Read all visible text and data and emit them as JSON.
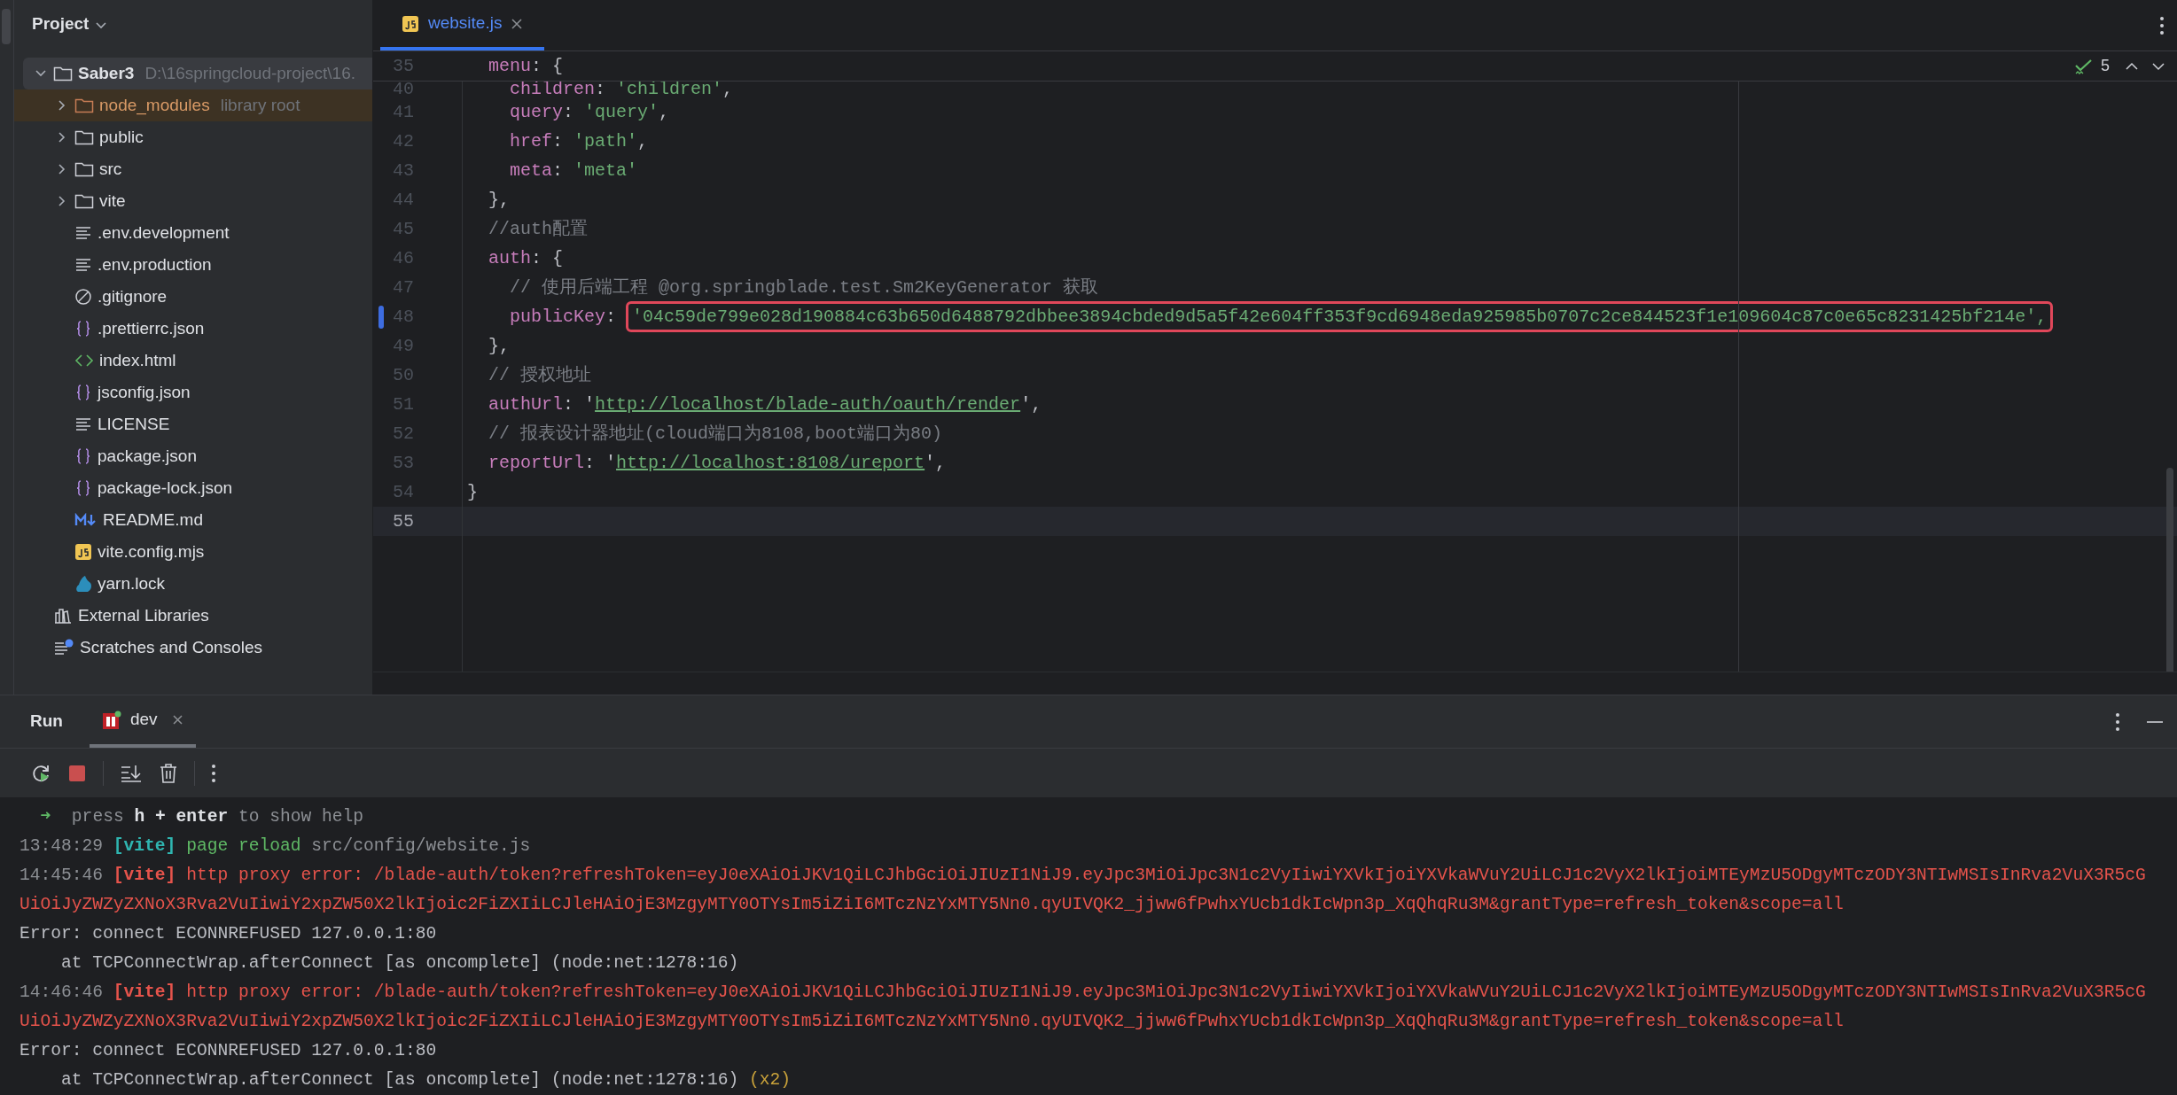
{
  "project_panel": {
    "title": "Project",
    "tree": [
      {
        "label": "Saber3",
        "hint": "D:\\16springcloud-project\\16.",
        "kind": "folder",
        "expanded": true,
        "children": [
          {
            "label": "node_modules",
            "hint": "library root",
            "kind": "library",
            "expanded": false
          },
          {
            "label": "public",
            "kind": "folder",
            "expanded": false
          },
          {
            "label": "src",
            "kind": "folder",
            "expanded": false
          },
          {
            "label": "vite",
            "kind": "folder",
            "expanded": false
          },
          {
            "label": ".env.development",
            "kind": "text"
          },
          {
            "label": ".env.production",
            "kind": "text"
          },
          {
            "label": ".gitignore",
            "kind": "ignore"
          },
          {
            "label": ".prettierrc.json",
            "kind": "json"
          },
          {
            "label": "index.html",
            "kind": "html"
          },
          {
            "label": "jsconfig.json",
            "kind": "json"
          },
          {
            "label": "LICENSE",
            "kind": "text"
          },
          {
            "label": "package.json",
            "kind": "json"
          },
          {
            "label": "package-lock.json",
            "kind": "json"
          },
          {
            "label": "README.md",
            "kind": "markdown"
          },
          {
            "label": "vite.config.mjs",
            "kind": "js"
          },
          {
            "label": "yarn.lock",
            "kind": "yarn"
          }
        ]
      },
      {
        "label": "External Libraries",
        "kind": "libraries"
      },
      {
        "label": "Scratches and Consoles",
        "kind": "scratches"
      }
    ]
  },
  "editor": {
    "tabs": [
      {
        "label": "website.js",
        "selected": true
      }
    ],
    "inspections": "5",
    "lines": [
      {
        "number": "35",
        "sticky": true,
        "tokens": [
          {
            "t": "  menu",
            "kind": "key"
          },
          {
            "t": ": {",
            "kind": "punct"
          }
        ]
      },
      {
        "number": "40",
        "cut": true,
        "tokens": [
          {
            "t": "    children",
            "kind": "key"
          },
          {
            "t": ": ",
            "kind": "punct"
          },
          {
            "t": "'children'",
            "kind": "string"
          },
          {
            "t": ",",
            "kind": "punct"
          }
        ]
      },
      {
        "number": "41",
        "tokens": [
          {
            "t": "    query",
            "kind": "key"
          },
          {
            "t": ": ",
            "kind": "punct"
          },
          {
            "t": "'query'",
            "kind": "string"
          },
          {
            "t": ",",
            "kind": "punct"
          }
        ]
      },
      {
        "number": "42",
        "tokens": [
          {
            "t": "    href",
            "kind": "key"
          },
          {
            "t": ": ",
            "kind": "punct"
          },
          {
            "t": "'path'",
            "kind": "string"
          },
          {
            "t": ",",
            "kind": "punct"
          }
        ]
      },
      {
        "number": "43",
        "tokens": [
          {
            "t": "    meta",
            "kind": "key"
          },
          {
            "t": ": ",
            "kind": "punct"
          },
          {
            "t": "'meta'",
            "kind": "string"
          }
        ]
      },
      {
        "number": "44",
        "tokens": [
          {
            "t": "  },",
            "kind": "punct"
          }
        ]
      },
      {
        "number": "45",
        "tokens": [
          {
            "t": "  //auth配置",
            "kind": "comment"
          }
        ]
      },
      {
        "number": "46",
        "tokens": [
          {
            "t": "  auth",
            "kind": "key"
          },
          {
            "t": ": {",
            "kind": "punct"
          }
        ]
      },
      {
        "number": "47",
        "tokens": [
          {
            "t": "    // 使用后端工程 @org.springblade.test.Sm2KeyGenerator 获取",
            "kind": "comment"
          }
        ]
      },
      {
        "number": "48",
        "modified": true,
        "tokens": [
          {
            "t": "    publicKey",
            "kind": "key"
          },
          {
            "t": ": ",
            "kind": "punct"
          },
          {
            "t": "'04c59de799e028d190884c63b650d6488792dbbee3894cbded9d5a5f42e604ff353f9cd6948eda925985b0707c2ce844523f1e109604c87c0e65c8231425bf214e',",
            "kind": "string",
            "boxed": true
          }
        ]
      },
      {
        "number": "49",
        "tokens": [
          {
            "t": "  },",
            "kind": "punct"
          }
        ]
      },
      {
        "number": "50",
        "tokens": [
          {
            "t": "  // 授权地址",
            "kind": "comment"
          }
        ]
      },
      {
        "number": "51",
        "tokens": [
          {
            "t": "  authUrl",
            "kind": "key"
          },
          {
            "t": ": '",
            "kind": "punct"
          },
          {
            "t": "http://localhost/blade-auth/oauth/render",
            "kind": "link"
          },
          {
            "t": "',",
            "kind": "punct"
          }
        ]
      },
      {
        "number": "52",
        "tokens": [
          {
            "t": "  // 报表设计器地址(cloud端口为8108,boot端口为80)",
            "kind": "comment"
          }
        ]
      },
      {
        "number": "53",
        "tokens": [
          {
            "t": "  reportUrl",
            "kind": "key"
          },
          {
            "t": ": '",
            "kind": "punct"
          },
          {
            "t": "http://localhost:8108/ureport",
            "kind": "link"
          },
          {
            "t": "',",
            "kind": "punct"
          }
        ]
      },
      {
        "number": "54",
        "tokens": [
          {
            "t": "}",
            "kind": "punct"
          }
        ]
      },
      {
        "number": "55",
        "current": true
      }
    ]
  },
  "run_panel": {
    "title": "Run",
    "tabs": [
      {
        "label": "dev",
        "selected": true
      }
    ],
    "console": [
      {
        "segments": [
          {
            "t": "  ➜  ",
            "kind": "green"
          },
          {
            "t": "press ",
            "kind": "dim"
          },
          {
            "t": "h + enter",
            "kind": "bold"
          },
          {
            "t": " to show help",
            "kind": "dim"
          }
        ]
      },
      {
        "segments": [
          {
            "t": "13:48:29 ",
            "kind": "dim"
          },
          {
            "t": "[vite]",
            "kind": "cyan"
          },
          {
            "t": " page reload",
            "kind": "green"
          },
          {
            "t": " src/config/website.js",
            "kind": "dim"
          }
        ]
      },
      {
        "segments": [
          {
            "t": "14:45:46 ",
            "kind": "dim"
          },
          {
            "t": "[vite]",
            "kind": "redbold"
          },
          {
            "t": " http proxy error: /blade-auth/token?refreshToken=eyJ0eXAiOiJKV1QiLCJhbGciOiJIUzI1NiJ9.eyJpc3MiOiJpc3N1c2VyIiwiYXVkIjoiYXVkaWVuY2UiLCJ1c2VyX2lkIjoiMTEyMzU5ODgyMTczODY3NTIwMSIsInRva2VuX3R5cGUiOiJyZWZyZXNoX3Rva2VuIiwiY2xpZW50X2lkIjoic2FiZXIiLCJleHAiOjE3MzgyMTY0OTYsIm5iZiI6MTczNzYxMTY5Nn0.qyUIVQK2_jjww6fPwhxYUcb1dkIcWpn3p_XqQhqRu3M&grantType=refresh_token&scope=all",
            "kind": "red"
          }
        ]
      },
      {
        "segments": [
          {
            "t": "Error: connect ECONNREFUSED 127.0.0.1:80",
            "kind": "plain"
          }
        ]
      },
      {
        "segments": [
          {
            "t": "    at TCPConnectWrap.afterConnect [as oncomplete] (node:net:1278:16)",
            "kind": "plain"
          }
        ]
      },
      {
        "segments": [
          {
            "t": "14:46:46 ",
            "kind": "dim"
          },
          {
            "t": "[vite]",
            "kind": "redbold"
          },
          {
            "t": " http proxy error: /blade-auth/token?refreshToken=eyJ0eXAiOiJKV1QiLCJhbGciOiJIUzI1NiJ9.eyJpc3MiOiJpc3N1c2VyIiwiYXVkIjoiYXVkaWVuY2UiLCJ1c2VyX2lkIjoiMTEyMzU5ODgyMTczODY3NTIwMSIsInRva2VuX3R5cGUiOiJyZWZyZXNoX3Rva2VuIiwiY2xpZW50X2lkIjoic2FiZXIiLCJleHAiOjE3MzgyMTY0OTYsIm5iZiI6MTczNzYxMTY5Nn0.qyUIVQK2_jjww6fPwhxYUcb1dkIcWpn3p_XqQhqRu3M&grantType=refresh_token&scope=all",
            "kind": "red"
          }
        ]
      },
      {
        "segments": [
          {
            "t": "Error: connect ECONNREFUSED 127.0.0.1:80",
            "kind": "plain"
          }
        ]
      },
      {
        "segments": [
          {
            "t": "    at TCPConnectWrap.afterConnect [as oncomplete] (node:net:1278:16)",
            "kind": "plain"
          },
          {
            "t": " (x2)",
            "kind": "yellow"
          }
        ]
      }
    ]
  }
}
